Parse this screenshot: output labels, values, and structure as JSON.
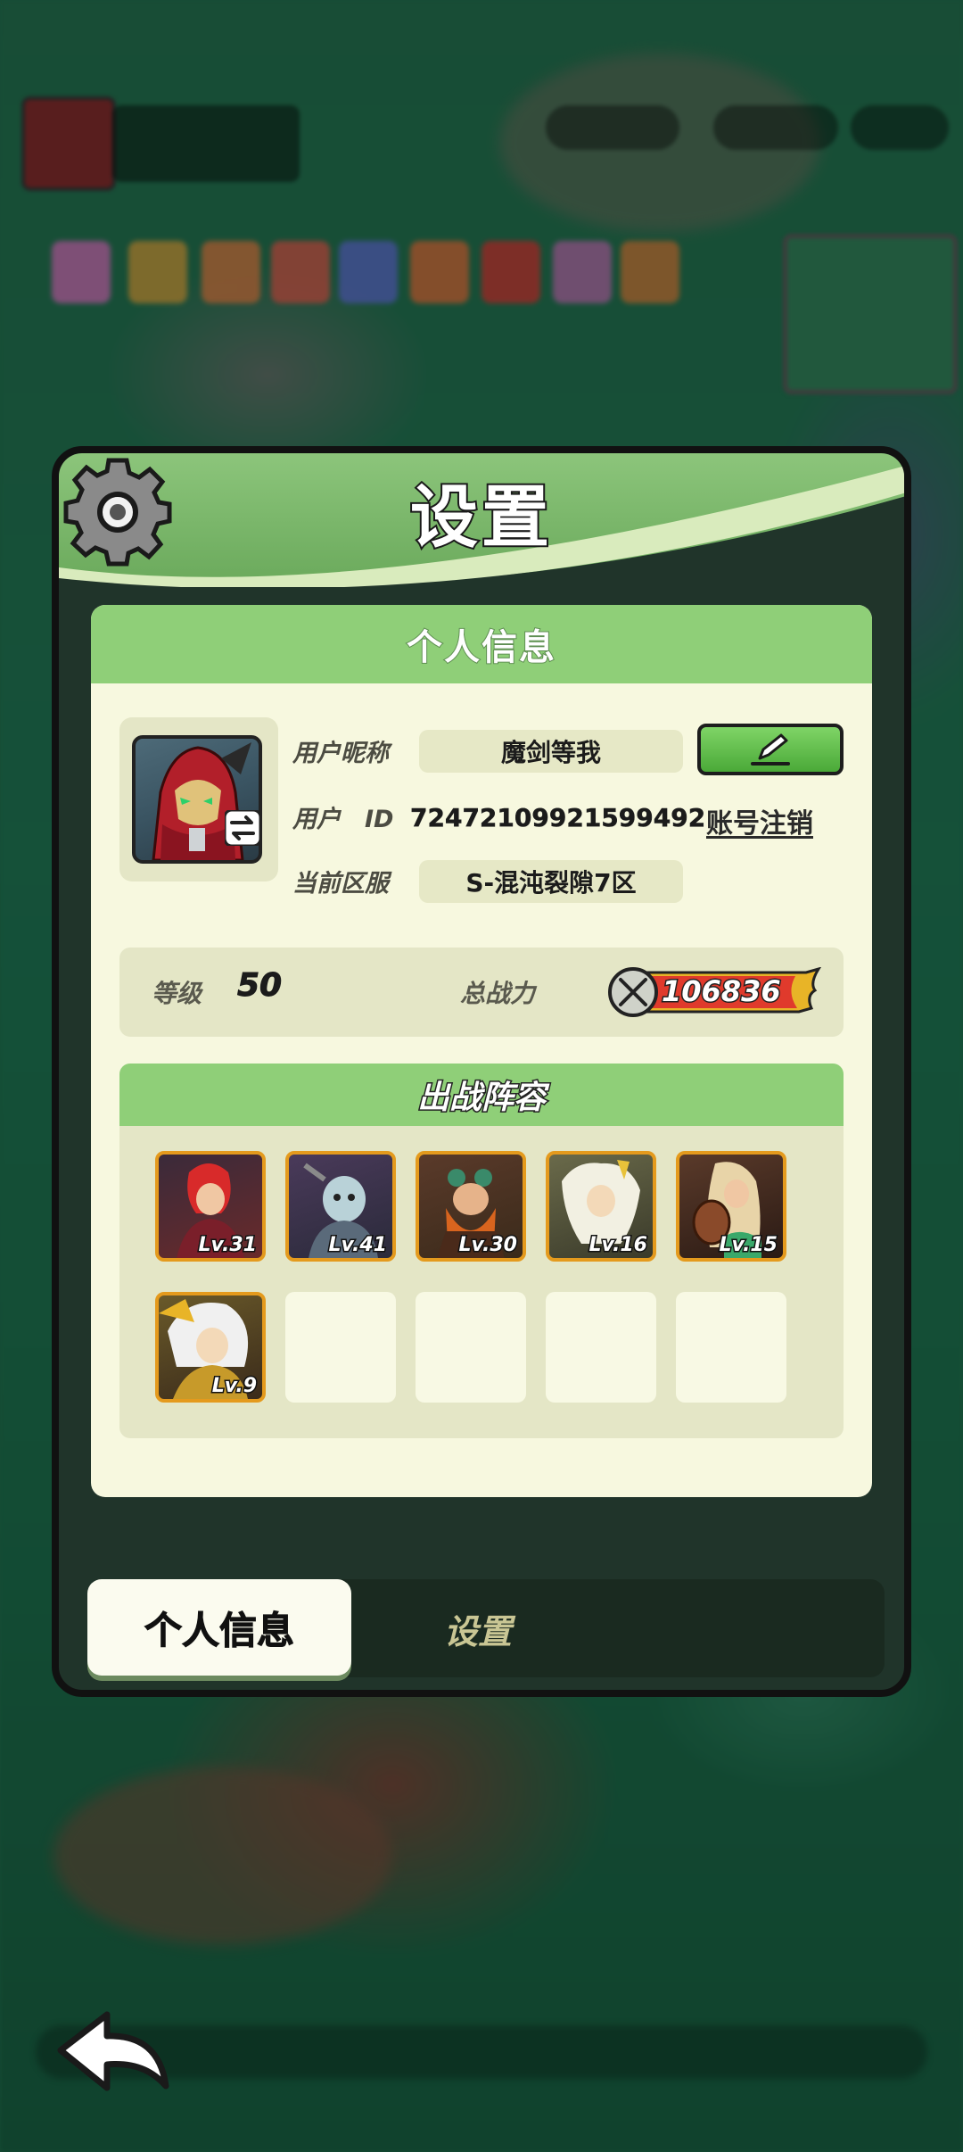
{
  "dialog": {
    "title": "设置",
    "section_title": "个人信息"
  },
  "profile": {
    "nickname_label": "用户昵称",
    "nickname": "魔剑等我",
    "uid_label": "用户　ID",
    "uid": "72472109921599492",
    "logout_label": "账号注销",
    "server_label": "当前区服",
    "server": "S-混沌裂隙7区"
  },
  "stats": {
    "level_label": "等级",
    "level": "50",
    "power_label": "总战力",
    "power": "106836"
  },
  "lineup": {
    "title": "出战阵容",
    "heroes": [
      {
        "level": "Lv.31"
      },
      {
        "level": "Lv.41"
      },
      {
        "level": "Lv.30"
      },
      {
        "level": "Lv.16"
      },
      {
        "level": "Lv.15"
      },
      {
        "level": "Lv.9"
      }
    ],
    "empty_slots": 4
  },
  "tabs": [
    {
      "label": "个人信息",
      "active": true
    },
    {
      "label": "设置",
      "active": false
    }
  ],
  "icons": {
    "gear": "gear-icon",
    "edit": "pencil-icon",
    "swap": "swap-icon",
    "power": "crossed-swords-icon",
    "back": "back-arrow-icon"
  },
  "colors": {
    "header_green": "#8cc57b",
    "accent_green": "#4aa938",
    "card_bg": "#f7f8df",
    "slot_border": "#e49a1d"
  }
}
